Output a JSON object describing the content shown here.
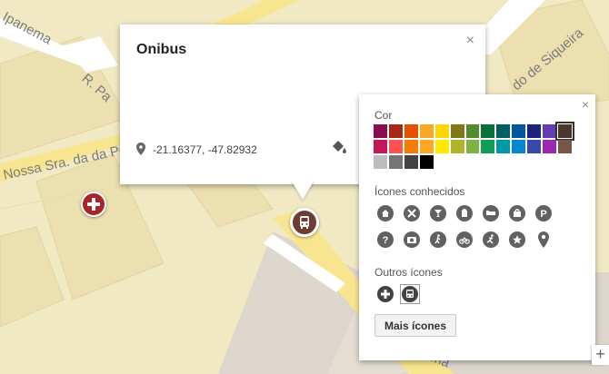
{
  "map": {
    "streets": [
      "Ipanema",
      "R. Pa",
      "Nossa Sra. da da Pe",
      "do de Siqueira",
      "ema"
    ],
    "colors": {
      "land": "#f1e9c4",
      "block": "#ecdfb0",
      "block_edge": "#e0d3a3",
      "road_major": "#f8e58f",
      "road_minor": "#ffffff",
      "gray_area": "#ddd6cc",
      "marker_brown": "#6d3c32",
      "marker_red": "#a82428"
    },
    "markers": [
      {
        "name": "hospital",
        "icon": "plus-icon"
      },
      {
        "name": "onibus",
        "icon": "bus-icon"
      }
    ]
  },
  "info_window": {
    "title": "Onibus",
    "close_label": "×",
    "coords": "-21.16377, -47.82932",
    "pin_icon": "pin-icon",
    "style_icon": "paint-bucket-icon"
  },
  "style_panel": {
    "close_label": "×",
    "color_title": "Cor",
    "colors": [
      [
        "#880e4f",
        "#a52714",
        "#e65100",
        "#f9a825",
        "#ffd600",
        "#817717",
        "#558b2f",
        "#097138",
        "#006064",
        "#01579b",
        "#1a237e",
        "#673ab7",
        "#4e342e"
      ],
      [
        "#c2185b",
        "#ff5252",
        "#f57c00",
        "#ffa726",
        "#ffea00",
        "#afb42b",
        "#7cb342",
        "#0f9d58",
        "#0097a7",
        "#0288d1",
        "#3949ab",
        "#9c27b0",
        "#795548"
      ],
      [
        "#bdbdbd",
        "#757575",
        "#424242",
        "#000000"
      ]
    ],
    "selected_color": "#4e342e",
    "known_icons_title": "Ícones conhecidos",
    "known_icons_row1": [
      "home-icon",
      "fork-knife-icon",
      "cocktail-icon",
      "landmark-icon",
      "bed-icon",
      "shopping-bag-icon",
      "parking-icon"
    ],
    "known_icons_row2": [
      "help-icon",
      "camera-icon",
      "walking-icon",
      "bicycle-icon",
      "running-icon",
      "star-icon",
      "pin-icon"
    ],
    "other_icons_title": "Outros ícones",
    "other_icons": [
      "plus-icon",
      "bus-icon"
    ],
    "selected_other_icon": "bus-icon",
    "more_button": "Mais ícones"
  },
  "zoom": {
    "plus": "+"
  }
}
